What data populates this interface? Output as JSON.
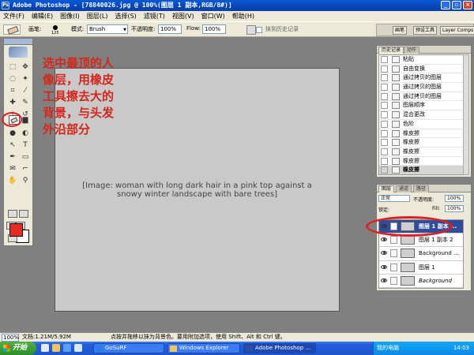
{
  "window": {
    "title": "Adobe Photoshop - [78840026.jpg @ 100%(图层 1 副本,RGB/8#)]"
  },
  "menu": [
    "文件(F)",
    "编辑(E)",
    "图像(I)",
    "图层(L)",
    "选择(S)",
    "滤镜(T)",
    "视图(V)",
    "窗口(W)",
    "帮助(H)"
  ],
  "options": {
    "brush_label": "画笔:",
    "brush_size": "125",
    "mode_label": "模式:",
    "mode_value": "Brush",
    "opacity_label": "不透明度:",
    "opacity_value": "100%",
    "flow_label": "Flow:",
    "flow_value": "100%",
    "history_label": "抹到历史记录"
  },
  "palette_well": [
    "画笔",
    "预设工具",
    "Layer Comps"
  ],
  "annotation": "选中最顶的人\n像层，用橡皮\n工具擦去大的\n背景，与头发\n外沿部分",
  "history": {
    "tabs": [
      "历史记录",
      "动作"
    ],
    "items": [
      {
        "label": "粘贴",
        "selected": false
      },
      {
        "label": "自由变换",
        "selected": false
      },
      {
        "label": "通过拷贝的图层",
        "selected": false
      },
      {
        "label": "通过拷贝的图层",
        "selected": false
      },
      {
        "label": "通过拷贝的图层",
        "selected": false
      },
      {
        "label": "图层顺序",
        "selected": false
      },
      {
        "label": "混合更改",
        "selected": false
      },
      {
        "label": "色阶",
        "selected": false
      },
      {
        "label": "橡皮擦",
        "selected": false
      },
      {
        "label": "橡皮擦",
        "selected": false
      },
      {
        "label": "橡皮擦",
        "selected": false
      },
      {
        "label": "橡皮擦",
        "selected": false
      },
      {
        "label": "橡皮擦",
        "selected": true
      }
    ]
  },
  "layers": {
    "tabs": [
      "图层",
      "通道",
      "路径"
    ],
    "blend_mode": "正常",
    "opacity_label": "不透明度:",
    "opacity_value": "100%",
    "lock_label": "锁定:",
    "fill_label": "Fill:",
    "fill_value": "100%",
    "items": [
      {
        "label": "图层 1 副本 ...",
        "selected": true
      },
      {
        "label": "图层 1 副本 2",
        "selected": false
      },
      {
        "label": "Background ...",
        "selected": false
      },
      {
        "label": "图层 1",
        "selected": false
      },
      {
        "label": "Background",
        "selected": false,
        "bg": true
      }
    ]
  },
  "status": {
    "zoom": "100%",
    "doc": "文档:1.21M/5.92M",
    "hint": "点按并拖移以抹为背景色。要用附加选项，使用 Shift、Alt 和 Ctrl 键。"
  },
  "taskbar": {
    "start": "开始",
    "tasks": [
      "GoSuRF",
      "Windows Explorer",
      "Adobe Photoshop ..."
    ],
    "tray_label": "我的电脑",
    "clock": "14:03"
  },
  "colors": {
    "foreground": "#e8291f",
    "background": "#ffffff",
    "annotation": "#d4261c",
    "highlight": "#e02020"
  }
}
